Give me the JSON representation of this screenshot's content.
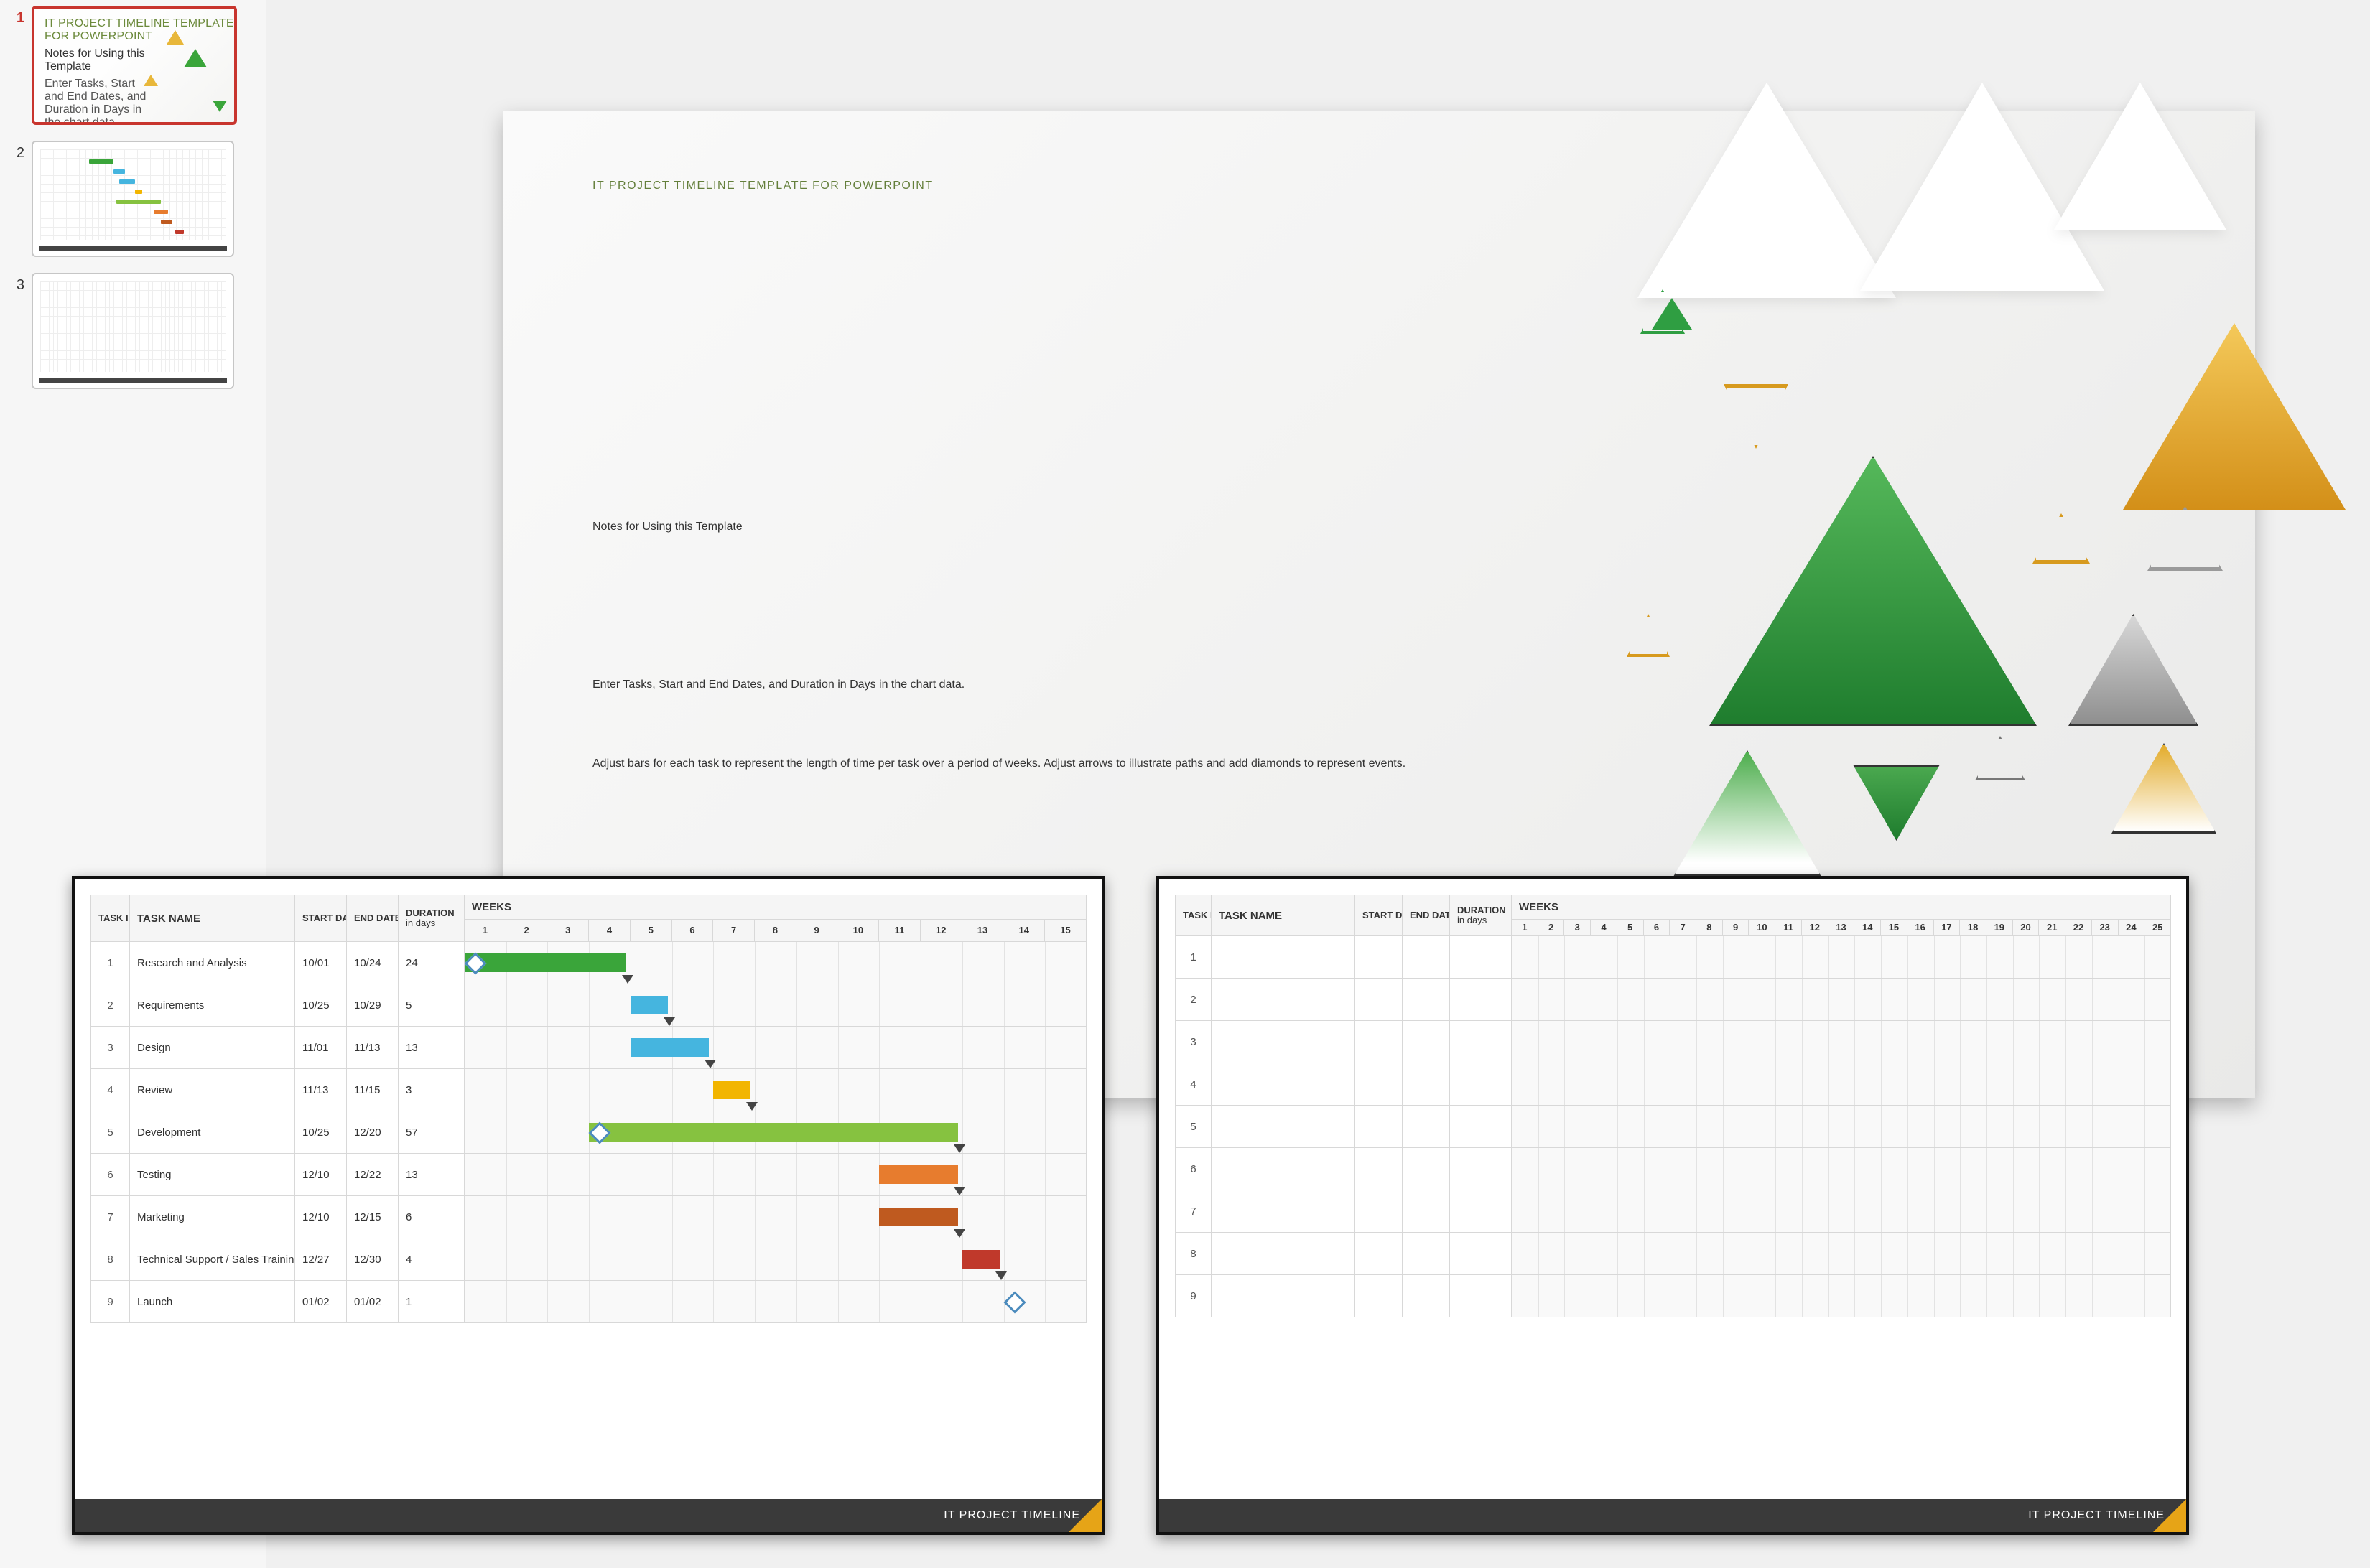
{
  "thumb_nums": {
    "n1": "1",
    "n2": "2",
    "n3": "3"
  },
  "slide1": {
    "header": "IT PROJECT TIMELINE TEMPLATE FOR POWERPOINT",
    "title": "Notes for Using this Template",
    "p1": "Enter Tasks, Start and End Dates, and Duration in Days in the chart data.",
    "p2": "Adjust bars for each task to represent the length of time per task over a period of weeks.  Adjust arrows to illustrate paths and add diamonds to represent events."
  },
  "gantt_headers": {
    "task_id": "TASK ID",
    "task_name": "TASK NAME",
    "start": "START DATE",
    "end": "END DATE",
    "dur": "DURATION",
    "dur_sub": "in days",
    "weeks": "WEEKS"
  },
  "weeks15": [
    "1",
    "2",
    "3",
    "4",
    "5",
    "6",
    "7",
    "8",
    "9",
    "10",
    "11",
    "12",
    "13",
    "14",
    "15"
  ],
  "weeks25": [
    "1",
    "2",
    "3",
    "4",
    "5",
    "6",
    "7",
    "8",
    "9",
    "10",
    "11",
    "12",
    "13",
    "14",
    "15",
    "16",
    "17",
    "18",
    "19",
    "20",
    "21",
    "22",
    "23",
    "24",
    "25"
  ],
  "footer_text": "IT PROJECT TIMELINE",
  "chart_data": {
    "type": "gantt",
    "title": "IT Project Timeline",
    "columns": [
      "TASK ID",
      "TASK NAME",
      "START DATE",
      "END DATE",
      "DURATION in days"
    ],
    "xlabel": "WEEKS",
    "x_range": [
      1,
      15
    ],
    "tasks": [
      {
        "id": "1",
        "name": "Research and Analysis",
        "start": "10/01",
        "end": "10/24",
        "duration": 24,
        "bar_start_week": 1,
        "bar_end_week": 4,
        "color": "#3aa53a",
        "milestone": true
      },
      {
        "id": "2",
        "name": "Requirements",
        "start": "10/25",
        "end": "10/29",
        "duration": 5,
        "bar_start_week": 5,
        "bar_end_week": 5,
        "color": "#45b5df"
      },
      {
        "id": "3",
        "name": "Design",
        "start": "11/01",
        "end": "11/13",
        "duration": 13,
        "bar_start_week": 5,
        "bar_end_week": 6,
        "color": "#45b5df"
      },
      {
        "id": "4",
        "name": "Review",
        "start": "11/13",
        "end": "11/15",
        "duration": 3,
        "bar_start_week": 7,
        "bar_end_week": 7,
        "color": "#f2b500"
      },
      {
        "id": "5",
        "name": "Development",
        "start": "10/25",
        "end": "12/20",
        "duration": 57,
        "bar_start_week": 4,
        "bar_end_week": 12,
        "color": "#86c240",
        "milestone": true
      },
      {
        "id": "6",
        "name": "Testing",
        "start": "12/10",
        "end": "12/22",
        "duration": 13,
        "bar_start_week": 11,
        "bar_end_week": 12,
        "color": "#e77c2e"
      },
      {
        "id": "7",
        "name": "Marketing",
        "start": "12/10",
        "end": "12/15",
        "duration": 6,
        "bar_start_week": 11,
        "bar_end_week": 12,
        "color": "#bf5a1f"
      },
      {
        "id": "8",
        "name": "Technical Support / Sales Training",
        "start": "12/27",
        "end": "12/30",
        "duration": 4,
        "bar_start_week": 13,
        "bar_end_week": 13,
        "color": "#c0392b"
      },
      {
        "id": "9",
        "name": "Launch",
        "start": "01/02",
        "end": "01/02",
        "duration": 1,
        "bar_start_week": 14,
        "bar_end_week": 14,
        "color": "#4b8bbd",
        "milestone": true
      }
    ]
  },
  "gantt_blank_rows": [
    "1",
    "2",
    "3",
    "4",
    "5",
    "6",
    "7",
    "8",
    "9"
  ],
  "colors": {
    "accent_green": "#647f3b",
    "bar_green": "#3aa53a",
    "bar_lime": "#86c240",
    "bar_blue": "#45b5df",
    "bar_yellow": "#f2b500",
    "bar_orange": "#e77c2e",
    "bar_brown": "#bf5a1f",
    "bar_red": "#c0392b",
    "diamond": "#4b8bbd",
    "footer_accent": "#e6a417"
  }
}
